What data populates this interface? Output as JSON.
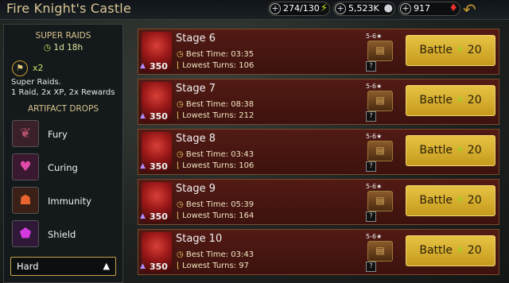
{
  "header": {
    "title": "Fire Knight's Castle",
    "energy": "274/130",
    "silver": "5,523K",
    "gems": "917",
    "plus": "+",
    "energy_icon": "⚡",
    "silver_icon": "●",
    "gem_icon": "♦",
    "back_icon": "↶"
  },
  "sidebar": {
    "super_raids_title": "SUPER RAIDS",
    "timer": "1d 18h",
    "multiplier": "x2",
    "desc_line1": "Super Raids.",
    "desc_line2": "1 Raid, 2x XP, 2x Rewards",
    "artifact_title": "ARTIFACT DROPS",
    "drops": [
      {
        "label": "Fury",
        "icon": "fury-icon",
        "color": "#b0506a"
      },
      {
        "label": "Curing",
        "icon": "curing-icon",
        "color": "#d63a9a"
      },
      {
        "label": "Immunity",
        "icon": "immunity-icon",
        "color": "#e0592a"
      },
      {
        "label": "Shield",
        "icon": "shield-icon",
        "color": "#c02ad0"
      }
    ],
    "difficulty": "Hard"
  },
  "stages": [
    {
      "name": "Stage 6",
      "best_time": "03:35",
      "lowest_turns": "106",
      "level": "350"
    },
    {
      "name": "Stage 7",
      "best_time": "08:38",
      "lowest_turns": "212",
      "level": "350"
    },
    {
      "name": "Stage 8",
      "best_time": "03:43",
      "lowest_turns": "106",
      "level": "350"
    },
    {
      "name": "Stage 9",
      "best_time": "05:39",
      "lowest_turns": "164",
      "level": "350"
    },
    {
      "name": "Stage 10",
      "best_time": "03:43",
      "lowest_turns": "97",
      "level": "350"
    }
  ],
  "labels": {
    "best_time": "Best Time:",
    "lowest_turns": "Lowest Turns:",
    "battle": "Battle",
    "battle_cost": "20",
    "reward_rank": "5-6★",
    "unknown": "?"
  }
}
